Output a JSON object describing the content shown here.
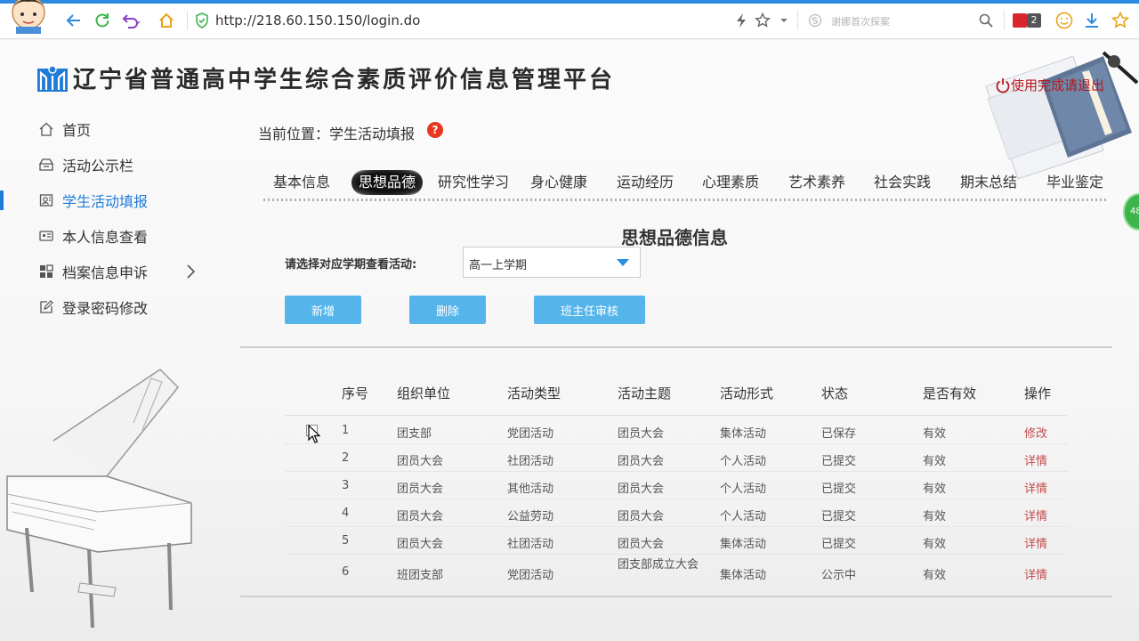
{
  "browser": {
    "url": "http://218.60.150.150/login.do",
    "search_placeholder": "谢娜首次探案",
    "badge_count": "2"
  },
  "header": {
    "title": "辽宁省普通高中学生综合素质评价信息管理平台",
    "logout": "使用完成请退出"
  },
  "sidebar": {
    "items": [
      {
        "label": "首页",
        "icon": "home-icon"
      },
      {
        "label": "活动公示栏",
        "icon": "bulletin-icon"
      },
      {
        "label": "学生活动填报",
        "icon": "student-form-icon",
        "active": true
      },
      {
        "label": "本人信息查看",
        "icon": "id-card-icon"
      },
      {
        "label": "档案信息申诉",
        "icon": "grid-icon"
      },
      {
        "label": "登录密码修改",
        "icon": "edit-icon"
      }
    ]
  },
  "breadcrumb": "当前位置：学生活动填报",
  "help_icon": "?",
  "online_badge": "48",
  "tabs": [
    "基本信息",
    "思想品德",
    "研究性学习",
    "身心健康",
    "运动经历",
    "心理素质",
    "艺术素养",
    "社会实践",
    "期末总结",
    "毕业鉴定"
  ],
  "active_tab": "思想品德",
  "section_title": "思想品德信息",
  "filter": {
    "label": "请选择对应学期查看活动:",
    "value": "高一上学期"
  },
  "buttons": {
    "add": "新增",
    "delete": "删除",
    "review": "班主任审核"
  },
  "table": {
    "headers": [
      "序号",
      "组织单位",
      "活动类型",
      "活动主题",
      "活动形式",
      "状态",
      "是否有效",
      "操作"
    ],
    "rows": [
      [
        "1",
        "团支部",
        "党团活动",
        "团员大会",
        "集体活动",
        "已保存",
        "有效",
        "修改"
      ],
      [
        "2",
        "团员大会",
        "社团活动",
        "团员大会",
        "个人活动",
        "已提交",
        "有效",
        "详情"
      ],
      [
        "3",
        "团员大会",
        "其他活动",
        "团员大会",
        "个人活动",
        "已提交",
        "有效",
        "详情"
      ],
      [
        "4",
        "团员大会",
        "公益劳动",
        "团员大会",
        "个人活动",
        "已提交",
        "有效",
        "详情"
      ],
      [
        "5",
        "团员大会",
        "社团活动",
        "团员大会",
        "集体活动",
        "已提交",
        "有效",
        "详情"
      ],
      [
        "6",
        "班团支部",
        "党团活动",
        "团支部成立大会",
        "集体活动",
        "公示中",
        "有效",
        "详情"
      ]
    ]
  },
  "colors": {
    "accent": "#1f7bd8",
    "button": "#55b5ea",
    "link": "#c64a4a",
    "logout": "#b8171c"
  }
}
